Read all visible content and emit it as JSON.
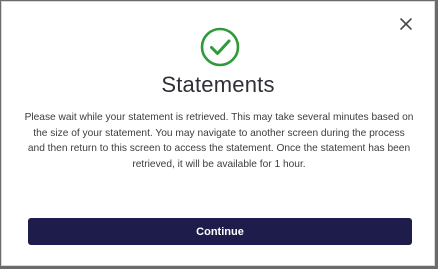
{
  "dialog": {
    "close_icon": "close-icon",
    "status_icon": "check-circle-icon",
    "status_color": "#2e9a3a",
    "title": "Statements",
    "message": "Please wait while your statement is retrieved. This may take several minutes based on the size of your statement. You may navigate to another screen during the process and then return to this screen to access the statement. Once the statement has been retrieved, it will be available for 1 hour.",
    "continue_label": "Continue",
    "button_color": "#1d1c4a"
  }
}
